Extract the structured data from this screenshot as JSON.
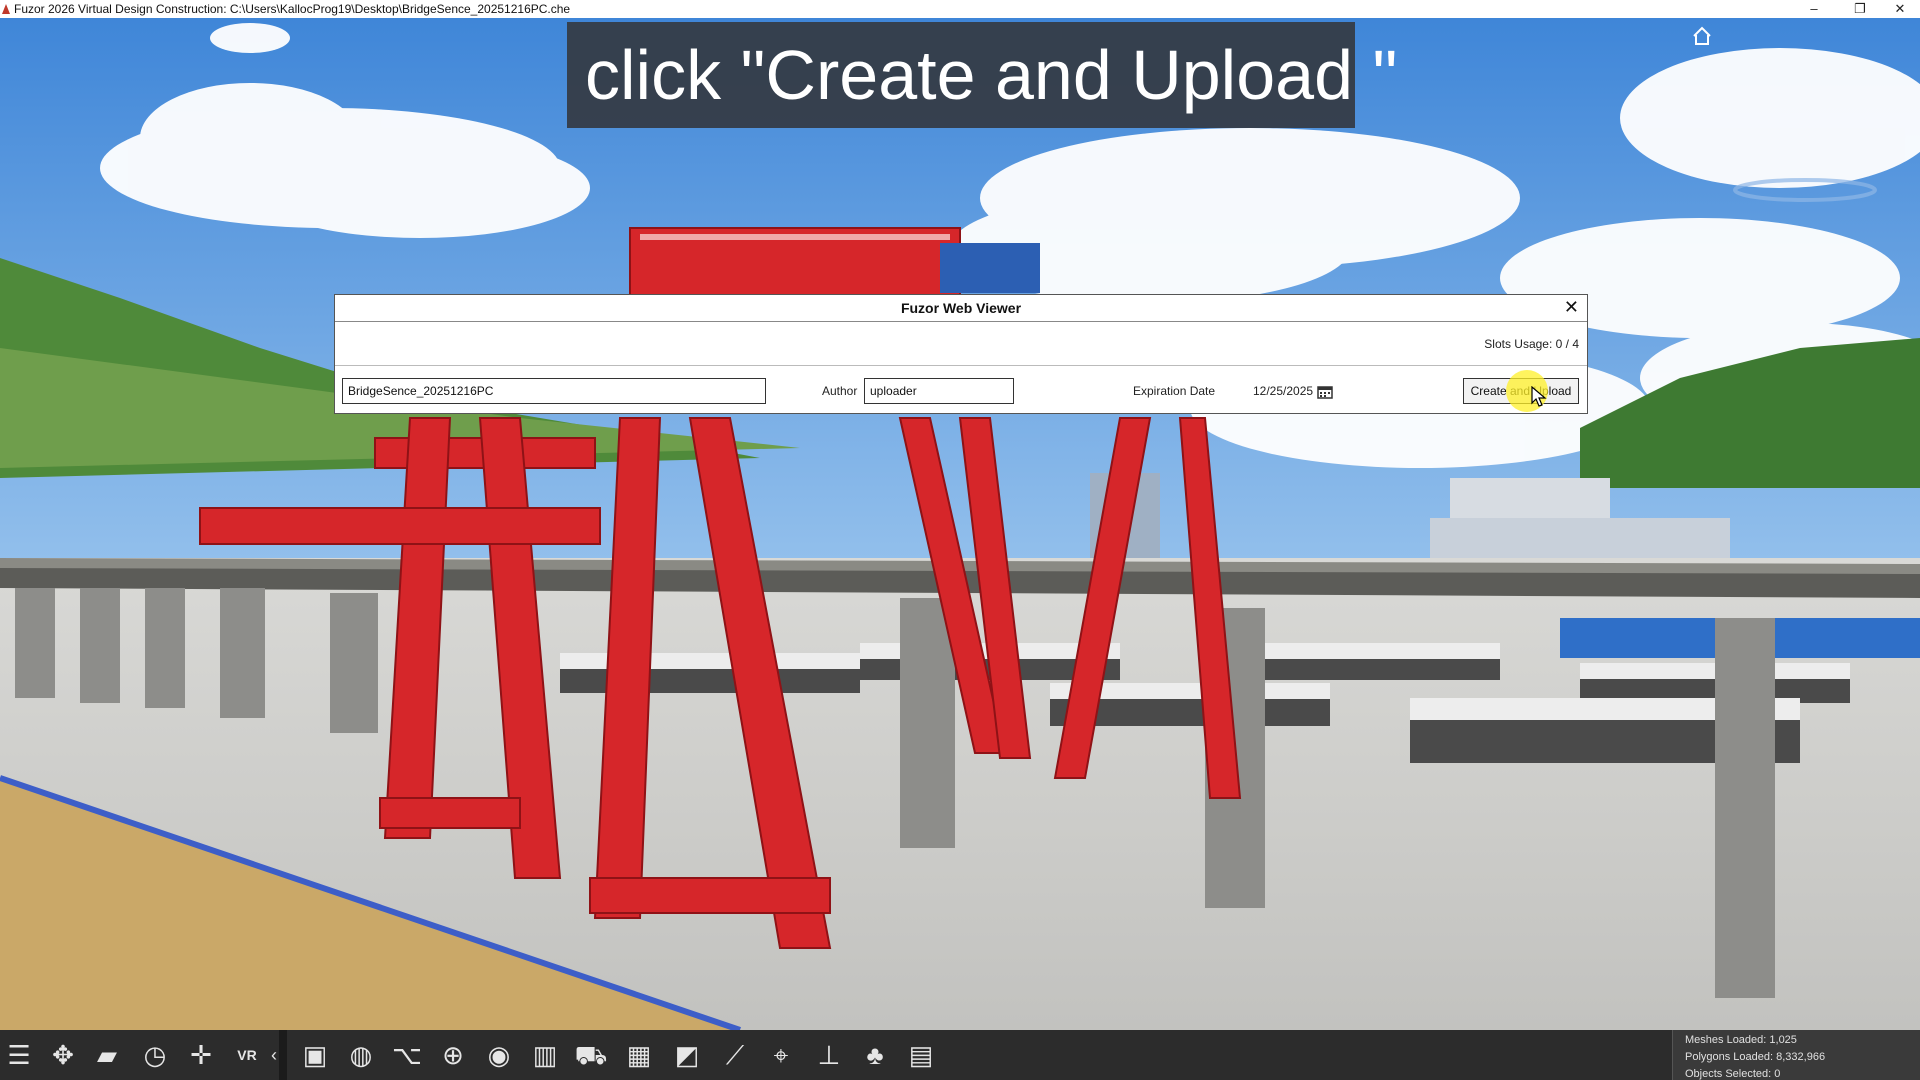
{
  "window": {
    "title": "Fuzor 2026 Virtual Design Construction: C:\\Users\\KallocProg19\\Desktop\\BridgeSence_20251216PC.che",
    "minimize": "–",
    "restore": "❐",
    "close": "✕"
  },
  "caption": "click \"Create and Upload \"",
  "dialog": {
    "title": "Fuzor Web Viewer",
    "close": "✕",
    "slots_usage": "Slots Usage: 0 / 4",
    "name_value": "BridgeSence_20251216PC",
    "author_label": "Author",
    "author_value": "uploader",
    "expiration_label": "Expiration Date",
    "expiration_value": "12/25/2025",
    "create_button": "Create and Upload"
  },
  "toolbar": {
    "icons": [
      "menu-icon",
      "drone-icon",
      "folder-icon",
      "clock-icon",
      "move-icon",
      "vr-icon",
      "collapse-arrow-icon",
      "screenshot-icon",
      "globe-icon",
      "path-icon",
      "lock-icon",
      "eye-icon",
      "building-icon",
      "vehicle-icon",
      "video-icon",
      "image-icon",
      "measure-icon",
      "location-icon",
      "section-icon",
      "tree-icon",
      "properties-icon"
    ],
    "vr_label": "VR",
    "collapse_label": "‹"
  },
  "stats": {
    "meshes": "Meshes Loaded: 1,025",
    "polygons": "Polygons Loaded: 8,332,966",
    "objects": "Objects Selected: 0"
  },
  "colors": {
    "caption_bg": "#343a42",
    "crane_red": "#d6262a",
    "toolbar_bg": "#2c2c2c",
    "highlight": "#fff028"
  }
}
